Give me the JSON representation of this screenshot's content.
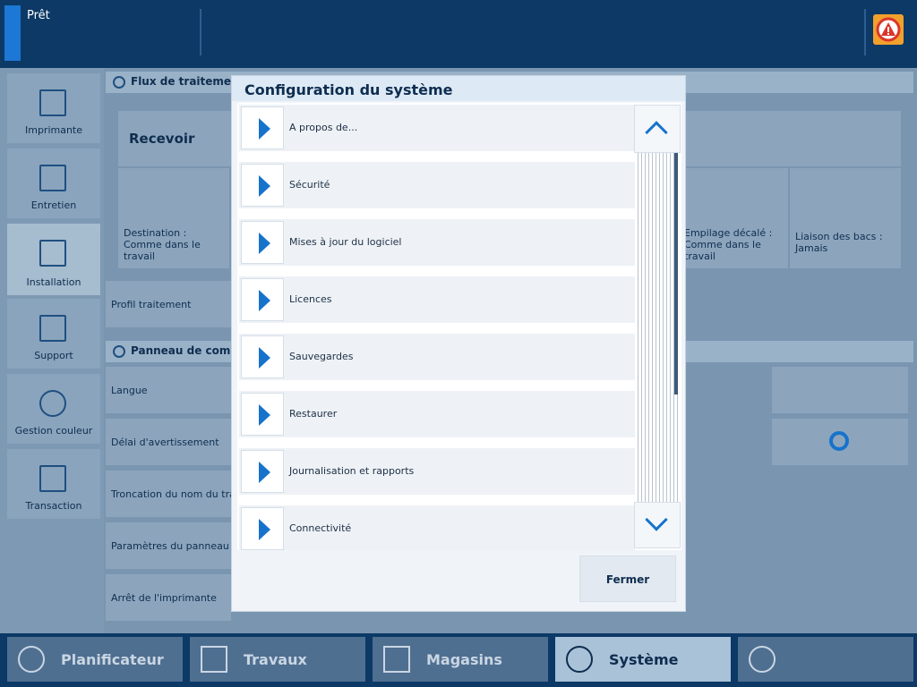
{
  "header": {
    "status": "Prêt"
  },
  "left_nav": [
    {
      "label": "Imprimante"
    },
    {
      "label": "Entretien"
    },
    {
      "label": "Installation"
    },
    {
      "label": "Support"
    },
    {
      "label": "Gestion couleur"
    },
    {
      "label": "Transaction"
    }
  ],
  "background": {
    "section1_title": "Flux de traitement",
    "recevoir": "Recevoir",
    "destination": "Destination : Comme dans le travail",
    "empilage": "Empilage décalé : Comme dans le travail",
    "liaison": "Liaison des bacs : Jamais",
    "profil": "Profil traitement",
    "section2_title": "Panneau de commande",
    "rows": [
      "Langue",
      "Délai d'avertissement",
      "Troncation du nom du travail",
      "Paramètres du panneau de",
      "Arrêt de l'imprimante"
    ]
  },
  "dialog": {
    "title": "Configuration du système",
    "items": [
      {
        "label": "A propos de..."
      },
      {
        "label": "Sécurité"
      },
      {
        "label": "Mises à jour du logiciel"
      },
      {
        "label": "Licences"
      },
      {
        "label": "Sauvegardes"
      },
      {
        "label": "Restaurer"
      },
      {
        "label": "Journalisation et rapports"
      },
      {
        "label": "Connectivité"
      }
    ],
    "close_label": "Fermer"
  },
  "taskbar": [
    {
      "label": "Planificateur",
      "icon": "clock-icon"
    },
    {
      "label": "Travaux",
      "icon": "document-icon"
    },
    {
      "label": "Magasins",
      "icon": "tray-icon"
    },
    {
      "label": "Système",
      "icon": "gear-icon"
    },
    {
      "label": "",
      "icon": "user-key-icon"
    }
  ],
  "colors": {
    "header_bg": "#0c3966",
    "accent": "#1673cc",
    "alert": "#f2a02c"
  }
}
